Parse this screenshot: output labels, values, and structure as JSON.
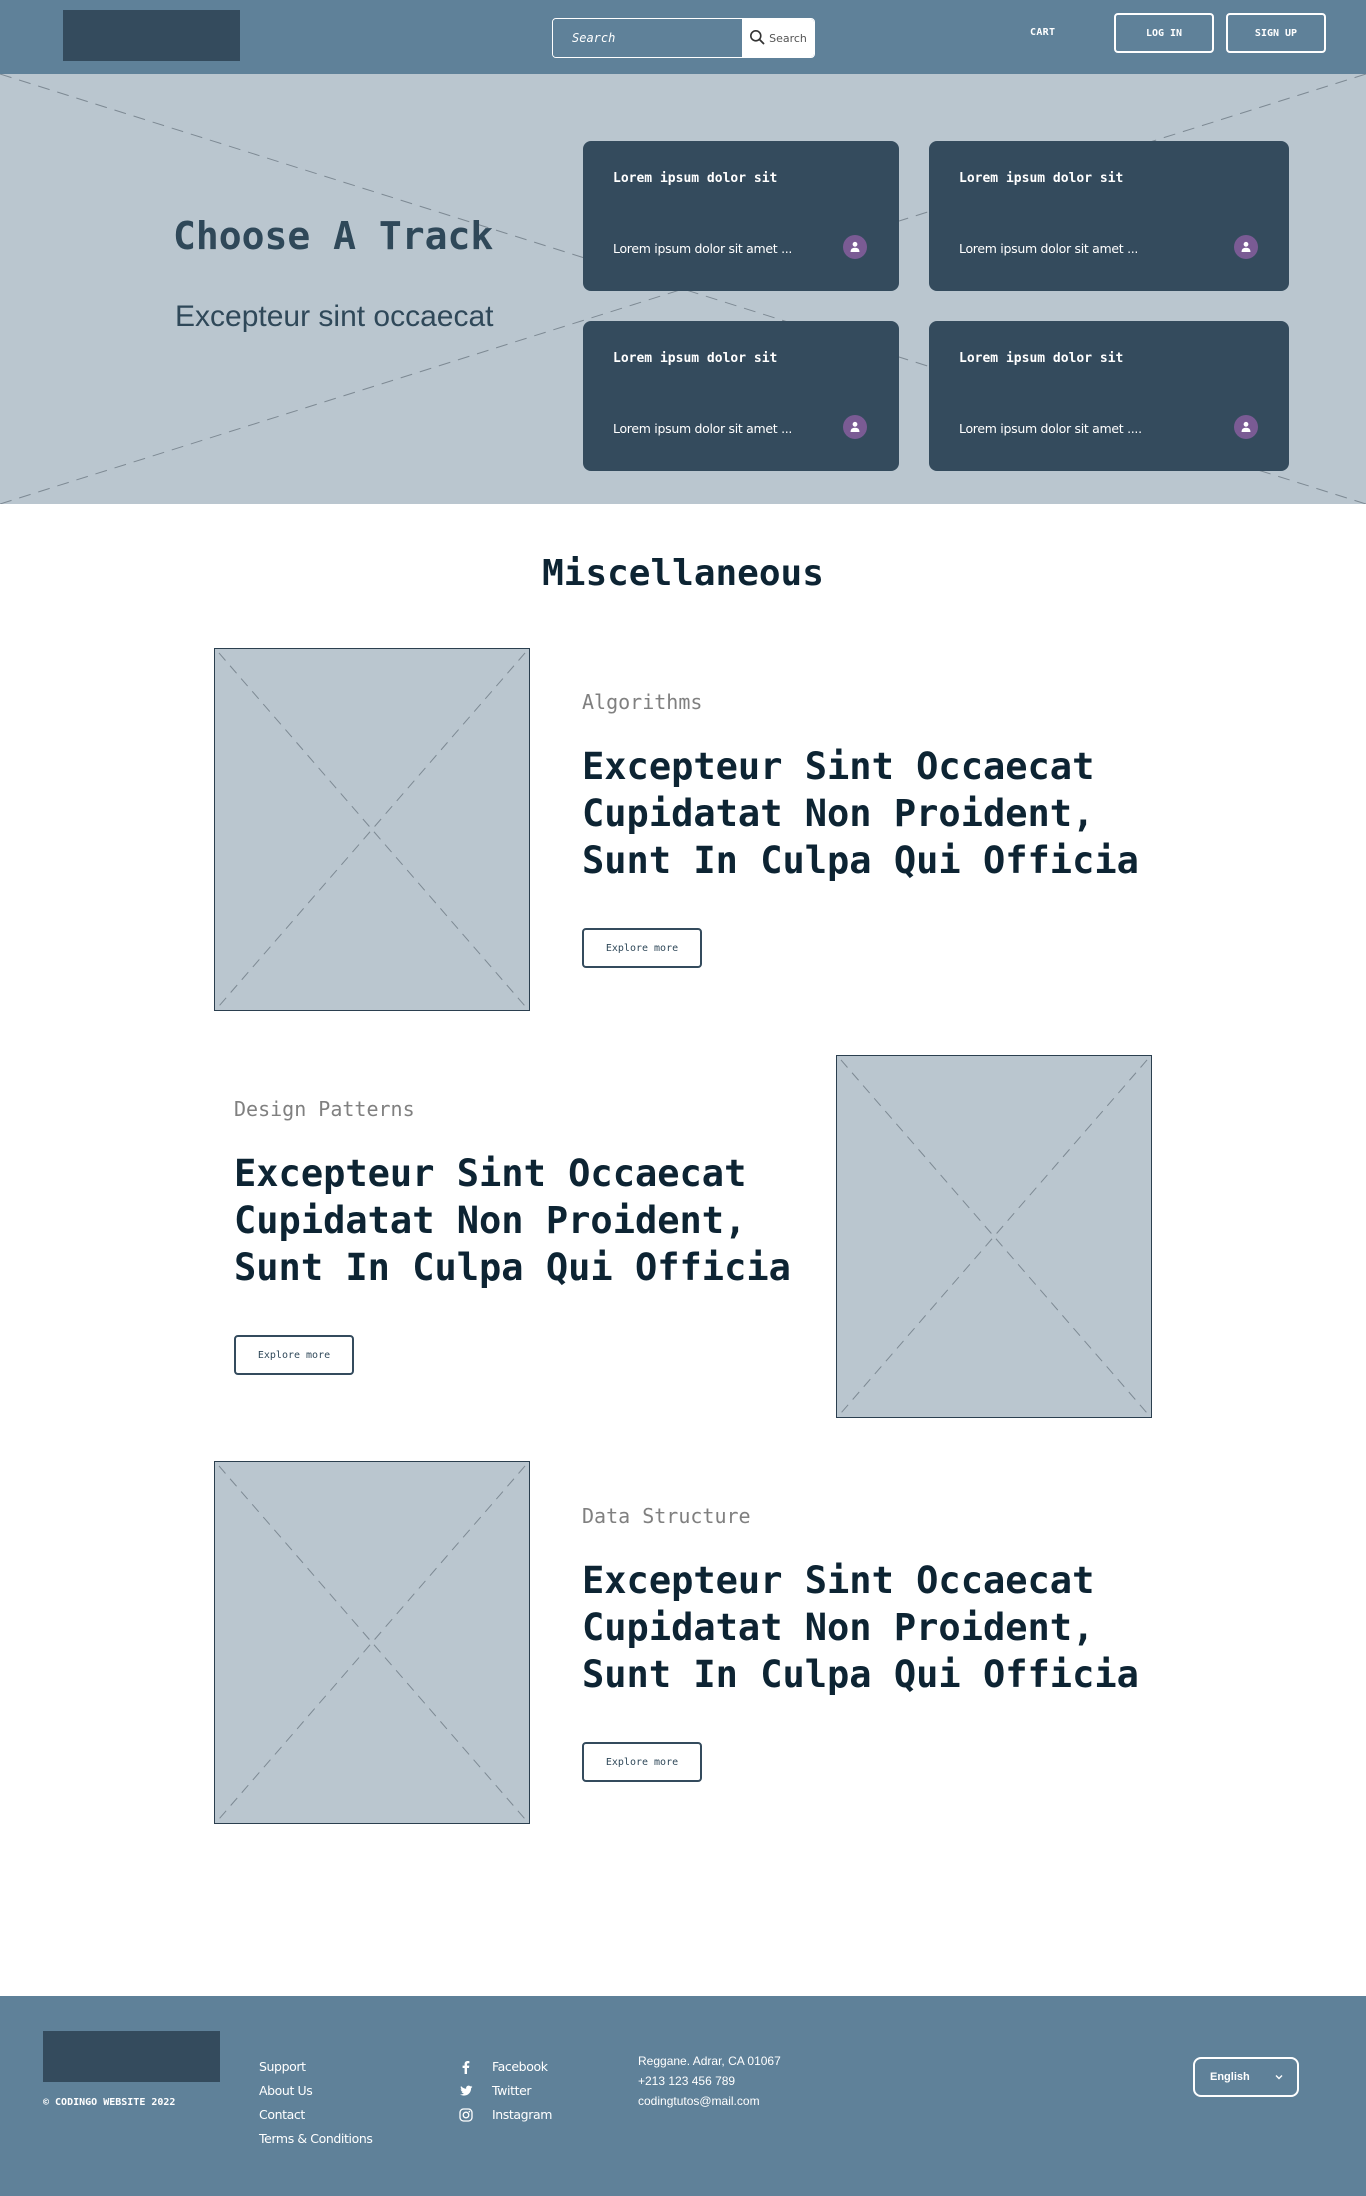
{
  "header": {
    "search": {
      "placeholder": "Search",
      "button_label": "Search"
    },
    "nav": {
      "cart_label": "CART",
      "login_label": "LOG IN",
      "signup_label": "SIGN UP"
    }
  },
  "hero": {
    "title": "Choose A Track",
    "subtitle": "Excepteur sint occaecat",
    "cards": [
      {
        "title": "Lorem ipsum dolor sit",
        "text": "Lorem ipsum dolor sit amet ...",
        "icon": "user-icon"
      },
      {
        "title": "Lorem ipsum dolor sit",
        "text": "Lorem ipsum dolor sit amet ...",
        "icon": "user-icon"
      },
      {
        "title": "Lorem ipsum dolor sit",
        "text": "Lorem ipsum dolor sit amet ...",
        "icon": "user-icon"
      },
      {
        "title": "Lorem ipsum dolor sit",
        "text": "Lorem ipsum dolor sit amet ....",
        "icon": "user-icon"
      }
    ]
  },
  "misc": {
    "title": "Miscellaneous",
    "features": [
      {
        "category": "Algorithms",
        "heading": "Excepteur Sint Occaecat\nCupidatat Non Proident,\nSunt In Culpa Qui Officia",
        "button_label": "Explore more"
      },
      {
        "category": "Design Patterns",
        "heading": "Excepteur Sint Occaecat\nCupidatat Non Proident,\nSunt In Culpa Qui Officia",
        "button_label": "Explore more"
      },
      {
        "category": "Data Structure",
        "heading": "Excepteur Sint Occaecat\nCupidatat Non Proident,\nSunt In Culpa Qui Officia",
        "button_label": "Explore more"
      }
    ]
  },
  "footer": {
    "copyright": "© CODINGO WEBSITE 2022",
    "links": [
      "Support",
      "About Us",
      "Contact",
      "Terms & Conditions"
    ],
    "social": [
      {
        "label": "Facebook",
        "icon": "facebook-icon"
      },
      {
        "label": "Twitter",
        "icon": "twitter-icon"
      },
      {
        "label": "Instagram",
        "icon": "instagram-icon"
      }
    ],
    "contact": {
      "address": "Reggane. Adrar, CA 01067",
      "phone": "+213 123 456 789",
      "email": "codingtutos@mail.com"
    },
    "language": {
      "selected": "English"
    }
  },
  "colors": {
    "header_bg": "#5f8199",
    "hero_bg": "#bac6cf",
    "card_bg": "#344b5d",
    "avatar_accent": "#7a5b94",
    "heading_text": "#0d2433"
  }
}
